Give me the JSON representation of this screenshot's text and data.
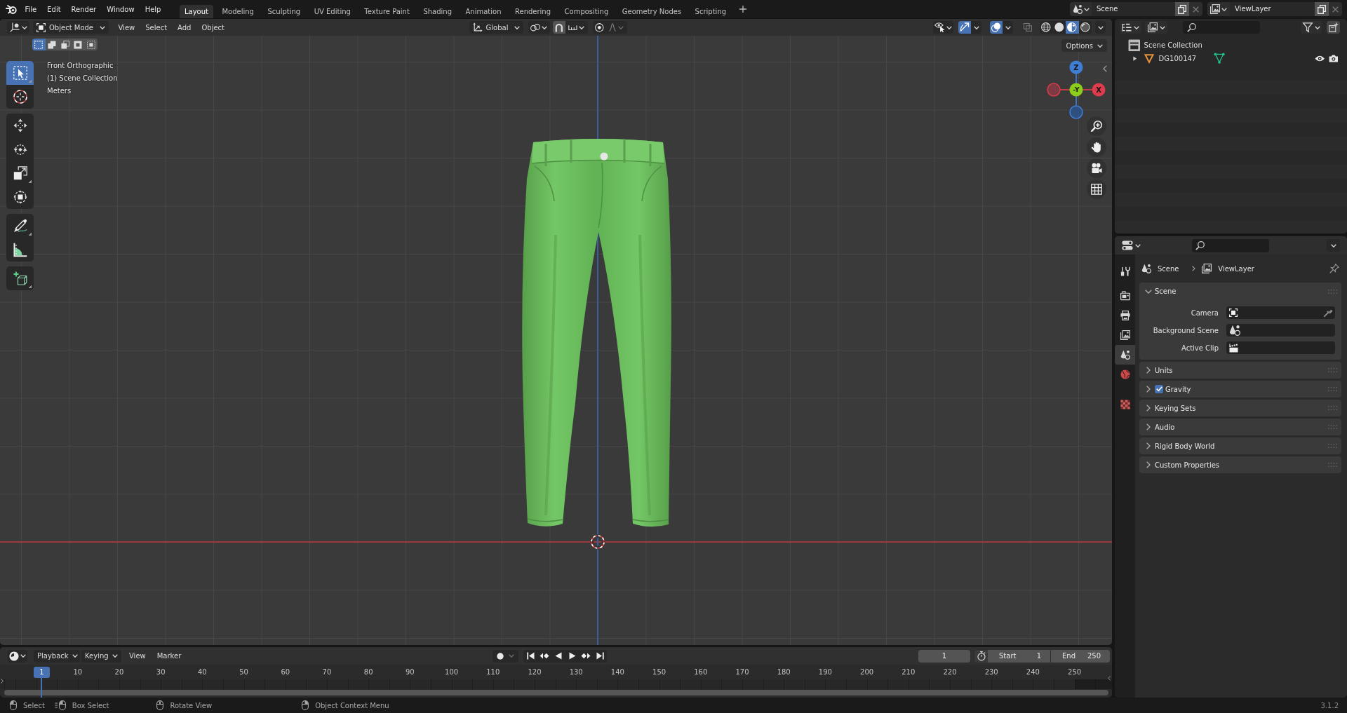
{
  "top_bar": {
    "menus": [
      "File",
      "Edit",
      "Render",
      "Window",
      "Help"
    ],
    "workspaces": [
      {
        "label": "Layout",
        "selected": true
      },
      {
        "label": "Modeling",
        "selected": false
      },
      {
        "label": "Sculpting",
        "selected": false
      },
      {
        "label": "UV Editing",
        "selected": false
      },
      {
        "label": "Texture Paint",
        "selected": false
      },
      {
        "label": "Shading",
        "selected": false
      },
      {
        "label": "Animation",
        "selected": false
      },
      {
        "label": "Rendering",
        "selected": false
      },
      {
        "label": "Compositing",
        "selected": false
      },
      {
        "label": "Geometry Nodes",
        "selected": false
      },
      {
        "label": "Scripting",
        "selected": false
      }
    ],
    "scene": "Scene",
    "view_layer": "ViewLayer"
  },
  "viewport": {
    "mode": "Object Mode",
    "menus": [
      "View",
      "Select",
      "Add",
      "Object"
    ],
    "orientation": "Global",
    "show_gizmos": true,
    "show_overlays": true,
    "xray": false,
    "shading_modes": [
      {
        "selected": false
      },
      {
        "selected": false
      },
      {
        "selected": true
      },
      {
        "selected": false
      }
    ],
    "options": "Options",
    "select_modes": [
      {
        "selected": true
      },
      {
        "selected": false
      },
      {
        "selected": false
      },
      {
        "selected": false
      },
      {
        "selected": false
      }
    ],
    "tools": [
      {
        "selected": true
      },
      {
        "selected": false
      },
      {
        "selected": false
      },
      {
        "selected": false
      },
      {
        "selected": false
      },
      {
        "selected": false
      },
      {
        "selected": false
      },
      {
        "selected": false
      },
      {
        "selected": false
      }
    ],
    "info": [
      "Front Orthographic",
      "(1) Scene Collection",
      "Meters"
    ],
    "gizmo_labels": {
      "z": "Z",
      "y": "-Y",
      "x": "X"
    }
  },
  "outliner": {
    "root": "Scene Collection",
    "objects": [
      {
        "name": "DG100147",
        "expanded": false
      }
    ]
  },
  "properties": {
    "tabs": [
      {
        "selected": false
      },
      {
        "selected": false
      },
      {
        "selected": false
      },
      {
        "selected": false
      },
      {
        "selected": true
      },
      {
        "selected": false
      },
      {
        "selected": false
      }
    ],
    "breadcrumb": [
      "Scene",
      "ViewLayer"
    ],
    "panels": [
      {
        "title": "Scene",
        "kind": "plain",
        "expanded": true,
        "fields": [
          "Camera",
          "Background Scene",
          "Active Clip"
        ]
      },
      {
        "title": "Units",
        "kind": "plain",
        "expanded": false
      },
      {
        "title": "Gravity",
        "kind": "toggle",
        "expanded": false,
        "checked": true
      },
      {
        "title": "Keying Sets",
        "kind": "plain",
        "expanded": false
      },
      {
        "title": "Audio",
        "kind": "plain",
        "expanded": false
      },
      {
        "title": "Rigid Body World",
        "kind": "plain",
        "expanded": false
      },
      {
        "title": "Custom Properties",
        "kind": "plain",
        "expanded": false
      }
    ]
  },
  "timeline": {
    "menus": [
      {
        "label": "Playback",
        "kind": "dropdown"
      },
      {
        "label": "Keying",
        "kind": "dropdown"
      },
      {
        "label": "View",
        "kind": "menu"
      },
      {
        "label": "Marker",
        "kind": "menu"
      }
    ],
    "current_frame": "1",
    "start": {
      "label": "Start",
      "value": "1"
    },
    "end": {
      "label": "End",
      "value": "250"
    },
    "playhead": "1",
    "ruler": [
      "10",
      "20",
      "30",
      "40",
      "50",
      "60",
      "70",
      "80",
      "90",
      "100",
      "110",
      "120",
      "130",
      "140",
      "150",
      "160",
      "170",
      "180",
      "190",
      "200",
      "210",
      "220",
      "230",
      "240",
      "250"
    ]
  },
  "status_bar": {
    "hints": [
      "Select",
      "Box Select",
      "Rotate View",
      "Object Context Menu"
    ],
    "version": "3.1.2"
  }
}
